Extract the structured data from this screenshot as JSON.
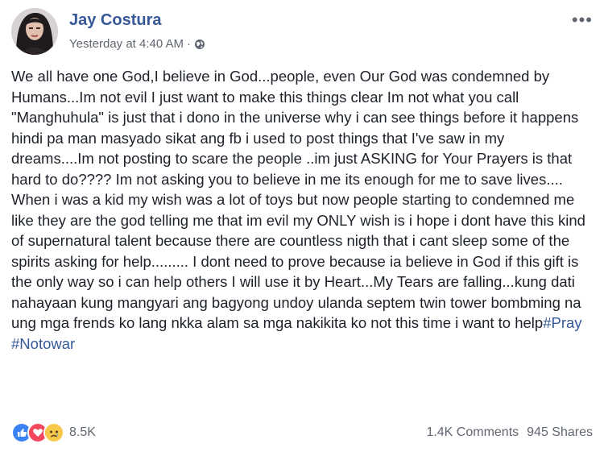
{
  "post": {
    "author": "Jay Costura",
    "timestamp": "Yesterday at 4:40 AM",
    "separator": "·",
    "privacy_icon": "globe-icon",
    "more_label": "•••",
    "body_text": "We all have one God,I believe in God...people, even Our God was condemned by Humans...Im not evil I just want to make this things clear Im not what you call \"Manghuhula\" is just that i dono in the universe why i can see things before it happens hindi pa man masyado sikat ang fb i used to post things that I've saw in my dreams....Im not posting to scare the people ..im just ASKING for Your Prayers is that hard to do???? Im not asking you to believe in me its enough for me to save lives.... When i was a kid my wish was a lot of toys but now people starting to condemned me like they are the god telling me that im evil my ONLY wish is i hope i dont have this kind of supernatural talent because there are countless nigth that i cant sleep some of the spirits asking for help......... I dont need to prove because ia believe in God if this gift is the only way so i can help others I will use it by Heart...My Tears are falling...kung dati nahayaan kung mangyari ang bagyong undoy ulanda septem twin tower bombming na ung mga frends ko lang nkka alam sa mga nakikita ko not this time i want to help",
    "hashtags": [
      "#Pray",
      "#Notowar"
    ]
  },
  "footer": {
    "reaction_icons": [
      "like-icon",
      "love-icon",
      "sad-icon"
    ],
    "reaction_count": "8.5K",
    "comments": "1.4K Comments",
    "shares": "945 Shares"
  },
  "colors": {
    "link": "#365899",
    "like": "#3b83f5",
    "love": "#f2475d",
    "sad": "#f7c94a"
  }
}
